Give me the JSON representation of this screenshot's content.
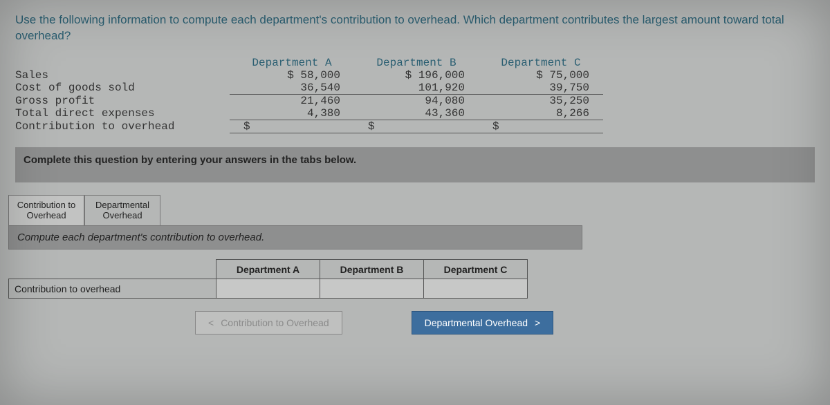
{
  "question": "Use the following information to compute each department's contribution to overhead. Which department contributes the largest amount toward total overhead?",
  "columns": {
    "a": "Department A",
    "b": "Department B",
    "c": "Department C"
  },
  "rows": {
    "sales": {
      "label": "Sales",
      "a": "$ 58,000",
      "b": "$ 196,000",
      "c": "$ 75,000"
    },
    "cogs": {
      "label": "Cost of goods sold",
      "a": "36,540",
      "b": "101,920",
      "c": "39,750"
    },
    "gross": {
      "label": "Gross profit",
      "a": "21,460",
      "b": "94,080",
      "c": "35,250"
    },
    "direct": {
      "label": "Total direct expenses",
      "a": "4,380",
      "b": "43,360",
      "c": "8,266"
    },
    "contrib": {
      "label": "Contribution to overhead",
      "a": "$",
      "b": "$",
      "c": "$"
    }
  },
  "instruction": "Complete this question by entering your answers in the tabs below.",
  "tabs": {
    "t1": "Contribution to Overhead",
    "t2": "Departmental Overhead"
  },
  "section_prompt": "Compute each department's contribution to overhead.",
  "answer_headers": {
    "a": "Department A",
    "b": "Department B",
    "c": "Department C"
  },
  "answer_rowlabel": "Contribution to overhead",
  "nav": {
    "prev": "Contribution to Overhead",
    "next": "Departmental Overhead"
  },
  "glyph": {
    "lt": "<",
    "gt": ">"
  }
}
